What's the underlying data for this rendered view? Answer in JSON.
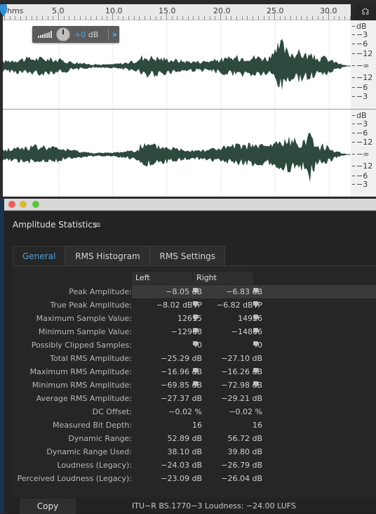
{
  "ruler": {
    "labels": [
      "hms",
      "5.0",
      "10.0",
      "15.0",
      "20.0",
      "25.0",
      "30.0"
    ]
  },
  "db_scale": {
    "channel1": [
      "dB",
      "−3",
      "−6",
      "−12",
      "−∞",
      "−12",
      "−6",
      "−3"
    ],
    "channel2": [
      "dB",
      "−3",
      "−6",
      "−12",
      "−∞",
      "−12",
      "−6",
      "−3"
    ]
  },
  "hud": {
    "value": "+0",
    "unit": "dB"
  },
  "colors": {
    "waveform": "#2e4a3f",
    "accent": "#4aa3e8"
  },
  "panel": {
    "title": "Amplitude Statistics",
    "menu_icon": "≡",
    "tabs": [
      "General",
      "RMS Histogram",
      "RMS Settings"
    ],
    "active_tab": "General",
    "columns": [
      "Left",
      "Right"
    ],
    "rows": [
      {
        "label": "Peak Amplitude:",
        "left": "−8.05 dB",
        "right": "−6.83 dB",
        "pin": true,
        "highlight": true
      },
      {
        "label": "True Peak Amplitude:",
        "left": "−8.02 dBTP",
        "right": "−6.82 dBTP",
        "pin": true
      },
      {
        "label": "Maximum Sample Value:",
        "left": "12615",
        "right": "14926",
        "pin": true
      },
      {
        "label": "Minimum Sample Value:",
        "left": "−12968",
        "right": "−14866",
        "pin": true
      },
      {
        "label": "Possibly Clipped Samples:",
        "left": "0",
        "right": "0",
        "pin": true
      },
      {
        "label": "Total RMS Amplitude:",
        "left": "−25.29 dB",
        "right": "−27.10 dB",
        "pin": false
      },
      {
        "label": "Maximum RMS Amplitude:",
        "left": "−16.96 dB",
        "right": "−16.26 dB",
        "pin": true
      },
      {
        "label": "Minimum RMS Amplitude:",
        "left": "−69.85 dB",
        "right": "−72.98 dB",
        "pin": true
      },
      {
        "label": "Average RMS Amplitude:",
        "left": "−27.37 dB",
        "right": "−29.21 dB",
        "pin": false
      },
      {
        "label": "DC Offset:",
        "left": "−0.02 %",
        "right": "−0.02 %",
        "pin": false
      },
      {
        "label": "Measured Bit Depth:",
        "left": "16",
        "right": "16",
        "pin": false
      },
      {
        "label": "Dynamic Range:",
        "left": "52.89 dB",
        "right": "56.72 dB",
        "pin": false
      },
      {
        "label": "Dynamic Range Used:",
        "left": "38.10 dB",
        "right": "39.80 dB",
        "pin": false
      },
      {
        "label": "Loudness (Legacy):",
        "left": "−24.03 dB",
        "right": "−26.79 dB",
        "pin": false
      },
      {
        "label": "Perceived Loudness (Legacy):",
        "left": "−23.09 dB",
        "right": "−26.04 dB",
        "pin": false
      }
    ],
    "copy_label": "Copy",
    "footer": "ITU−R BS.1770−3 Loudness: −24.00 LUFS"
  }
}
